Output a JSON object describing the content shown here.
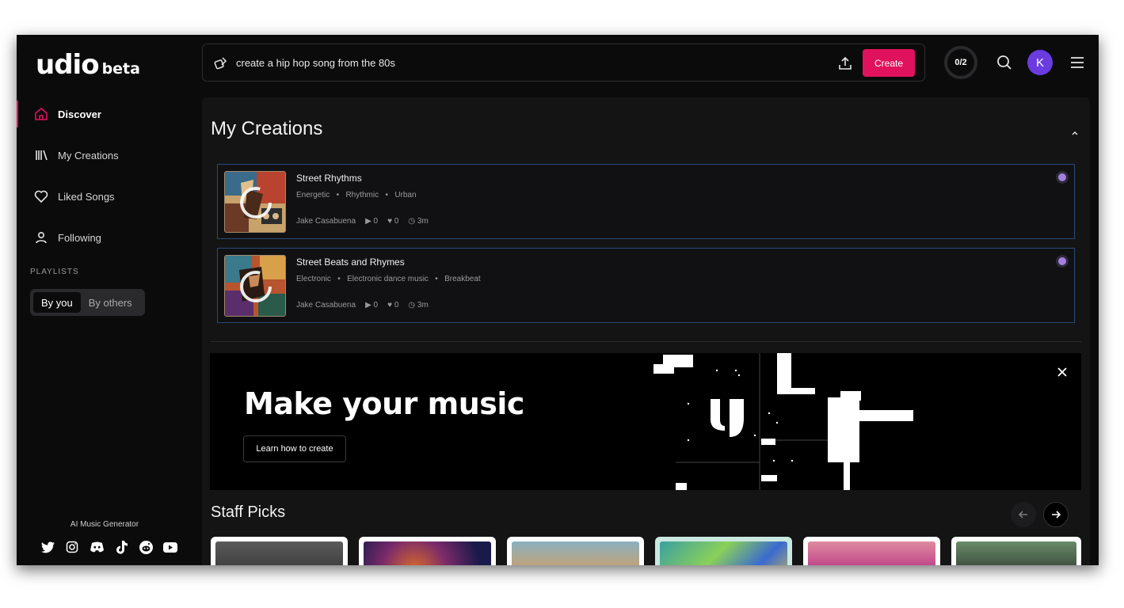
{
  "app": {
    "logo_main": "udio",
    "logo_sub": "beta"
  },
  "sidebar": {
    "items": [
      {
        "label": "Discover",
        "icon": "home-icon",
        "active": true
      },
      {
        "label": "My Creations",
        "icon": "library-icon"
      },
      {
        "label": "Liked Songs",
        "icon": "heart-icon"
      },
      {
        "label": "Following",
        "icon": "user-icon"
      }
    ],
    "playlists_label": "PLAYLISTS",
    "playlist_tabs": [
      "By you",
      "By others"
    ],
    "footer_label": "AI Music Generator",
    "socials": [
      "twitter-icon",
      "instagram-icon",
      "discord-icon",
      "tiktok-icon",
      "reddit-icon",
      "youtube-icon"
    ]
  },
  "topbar": {
    "prompt": "create a hip hop song from the 80s",
    "create_label": "Create",
    "credits": "0/2",
    "avatar_initial": "K"
  },
  "my_creations": {
    "title": "My Creations",
    "songs": [
      {
        "title": "Street Rhythms",
        "tags": [
          "Energetic",
          "Rhythmic",
          "Urban"
        ],
        "artist": "Jake Casabuena",
        "plays": "0",
        "likes": "0",
        "age": "3m"
      },
      {
        "title": "Street Beats and Rhymes",
        "tags": [
          "Electronic",
          "Electronic dance music",
          "Breakbeat"
        ],
        "artist": "Jake Casabuena",
        "plays": "0",
        "likes": "0",
        "age": "3m"
      }
    ]
  },
  "banner": {
    "title": "Make your music",
    "button": "Learn how to create"
  },
  "staff_picks": {
    "title": "Staff Picks"
  },
  "colors": {
    "accent": "#e0125d",
    "avatar": "#6a3ce0",
    "song_dot": "#a67de0",
    "song_border": "#2a4a7a"
  }
}
